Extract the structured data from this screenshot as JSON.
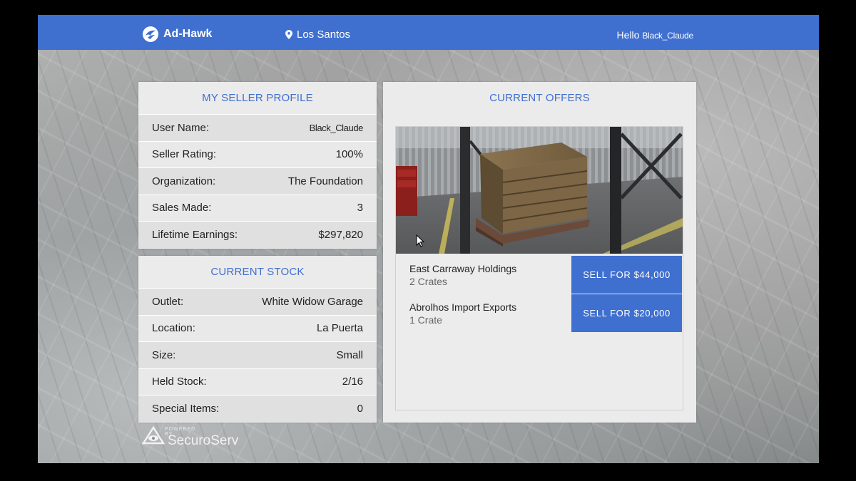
{
  "header": {
    "brand": "Ad-Hawk",
    "location": "Los Santos",
    "greeting": "Hello",
    "username": "Black_Claude"
  },
  "profile": {
    "title": "MY SELLER PROFILE",
    "rows": [
      {
        "label": "User Name:",
        "value": "Black_Claude"
      },
      {
        "label": "Seller Rating:",
        "value": "100%"
      },
      {
        "label": "Organization:",
        "value": "The Foundation"
      },
      {
        "label": "Sales Made:",
        "value": "3"
      },
      {
        "label": "Lifetime Earnings:",
        "value": "$297,820"
      }
    ]
  },
  "stock": {
    "title": "CURRENT STOCK",
    "rows": [
      {
        "label": "Outlet:",
        "value": "White Widow Garage"
      },
      {
        "label": "Location:",
        "value": "La Puerta"
      },
      {
        "label": "Size:",
        "value": "Small"
      },
      {
        "label": "Held Stock:",
        "value": "2/16"
      },
      {
        "label": "Special Items:",
        "value": "0"
      }
    ]
  },
  "offers": {
    "title": "CURRENT OFFERS",
    "items": [
      {
        "buyer": "East Carraway Holdings",
        "quantity": "2 Crates",
        "button": "SELL FOR $44,000"
      },
      {
        "buyer": "Abrolhos Import Exports",
        "quantity": "1 Crate",
        "button": "SELL FOR $20,000"
      }
    ]
  },
  "footer": {
    "powered_by": "POWERED BY",
    "provider": "SecuroServ"
  },
  "colors": {
    "accent": "#3f6fcf",
    "panel": "#ebebeb"
  },
  "icons": [
    "ad-hawk-logo-icon",
    "map-pin-icon",
    "securoserv-logo-icon",
    "mouse-cursor-icon"
  ]
}
